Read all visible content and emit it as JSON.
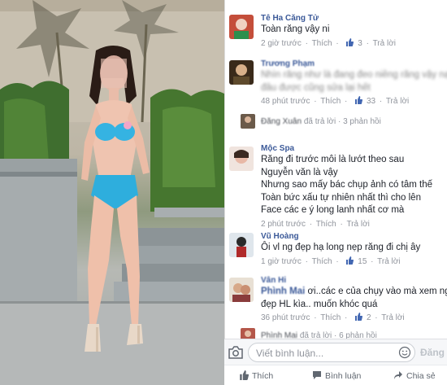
{
  "comments": [
    {
      "name": "Tê Ha Căng Tử",
      "text": [
        "Toàn răng vậy ni"
      ],
      "time": "2 giờ trước",
      "like_label": "Thích",
      "likes": "3",
      "reply_label": "Trả lời"
    },
    {
      "name": "Trương Phạm",
      "text": [
        "Nhìn răng như là đang đeo niềng răng vậy nạo",
        "đâu được cũng sửa lại hết"
      ],
      "time": "48 phút trước",
      "like_label": "Thích",
      "likes": "33",
      "reply_label": "Trả lời"
    },
    {
      "reply_name": "Đăng Xuân",
      "reply_text": "đã trả lời",
      "reply_count": "3 phản hồi"
    },
    {
      "name": "Mộc Spa",
      "text": [
        "Răng đi trước môi là lướt theo sau",
        "Nguyễn văn là vậy",
        "Nhưng sao mấy bác chụp ảnh có tâm thế",
        "Toàn bức xấu tự nhiên nhất thì cho lên",
        "Face các e ý long lanh nhất cơ mà"
      ],
      "time": "2 phút trước",
      "like_label": "Thích",
      "reply_label": "Trả lời"
    },
    {
      "name": "Vũ Hoàng",
      "text": [
        "Ôi vl ng đẹp hạ long nẹp răng đi chị ây"
      ],
      "time": "1 giờ trước",
      "like_label": "Thích",
      "likes": "15",
      "reply_label": "Trả lời"
    },
    {
      "name": "Vân Hi",
      "name2": "Phình Mai",
      "text_rest": "ơi..các e của chụy vào mà xem ng",
      "text": [
        "đẹp HL kìa.. muốn khóc quá"
      ],
      "time": "36 phút trước",
      "like_label": "Thích",
      "likes": "2",
      "reply_label": "Trả lời"
    },
    {
      "reply_name": "Phình Mai",
      "reply_text": "đã trả lời",
      "reply_count": "6 phản hồi"
    }
  ],
  "composer": {
    "placeholder": "Viết bình luận...",
    "post_label": "Đăng"
  },
  "actions": {
    "like": "Thích",
    "comment": "Bình luận",
    "share": "Chia sẻ"
  },
  "colors": {
    "link": "#3b5998",
    "like_blue": "#4267b2",
    "bikini": "#3cb4e0"
  }
}
